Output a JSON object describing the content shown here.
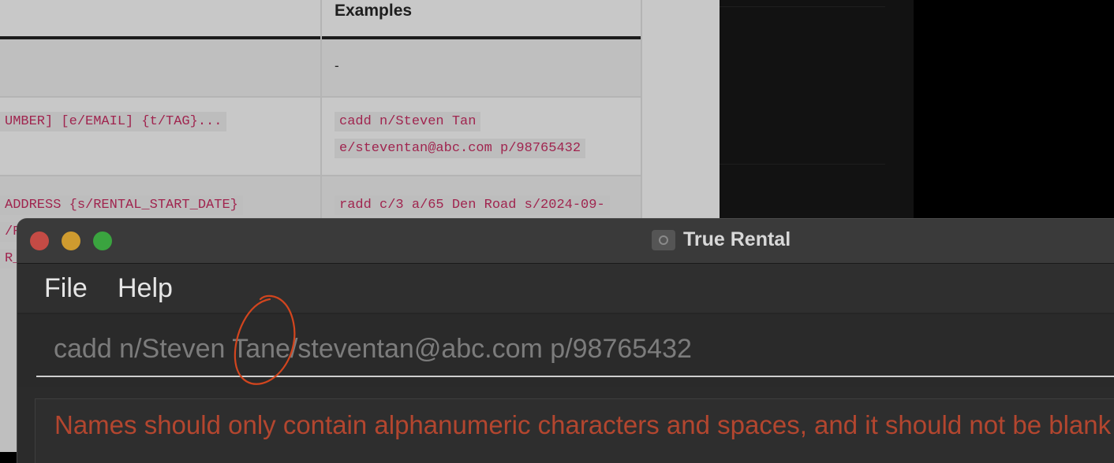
{
  "background_doc": {
    "header_examples": "Examples",
    "row1_example": "-",
    "row2_format": "UMBER] [e/EMAIL] {t/TAG}...",
    "row2_example_line1": "cadd n/Steven Tan",
    "row2_example_line2": "e/steventan@abc.com p/98765432",
    "row3_format_line1": "ADDRESS {s/RENTAL_START_DATE}",
    "row3_format_line2": "/R",
    "row3_format_line3": "R_",
    "row3_example_line1": "radd c/3 a/65 Den Road s/2024-09-"
  },
  "window": {
    "title": "True Rental",
    "menu": {
      "file": "File",
      "help": "Help"
    },
    "command_box": {
      "value": "cadd n/Steven Tane/steventan@abc.com p/98765432"
    },
    "result_message": "Names should only contain alphanumeric characters and spaces, and it should not be blank"
  },
  "colors": {
    "error_text": "#b3462f",
    "annotation_circle": "#d2451e",
    "traffic_close": "#c44b45",
    "traffic_minimize": "#cf9b2f",
    "traffic_zoom": "#3aa43f"
  },
  "icons": [
    "app-icon",
    "traffic-light-close",
    "traffic-light-minimize",
    "traffic-light-zoom"
  ]
}
